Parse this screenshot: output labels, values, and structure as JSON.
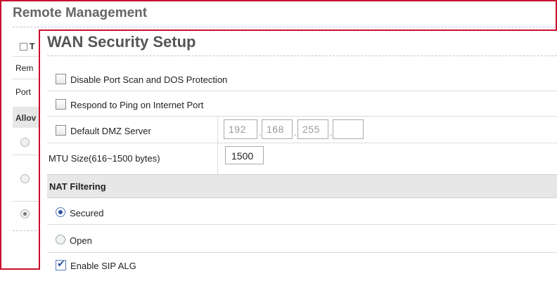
{
  "back_panel": {
    "title": "Remote Management",
    "header_checkbox_label": "T",
    "rows": [
      "Rem",
      "Port"
    ],
    "allow_section_label": "Allov",
    "radios": [
      {
        "checked": false
      },
      {
        "checked": false
      },
      {
        "checked": true
      }
    ]
  },
  "front_panel": {
    "title": "WAN Security Setup",
    "options": {
      "disable_port_scan": {
        "label": "Disable Port Scan and DOS Protection",
        "checked": false
      },
      "respond_ping": {
        "label": "Respond to Ping on Internet Port",
        "checked": false
      },
      "dmz": {
        "label": "Default DMZ Server",
        "checked": false,
        "ip": [
          "192",
          "168",
          "255",
          ""
        ]
      }
    },
    "mtu": {
      "label": "MTU Size(616~1500 bytes)",
      "value": "1500"
    },
    "nat_filtering": {
      "heading": "NAT Filtering",
      "options": [
        {
          "label": "Secured",
          "checked": true
        },
        {
          "label": "Open",
          "checked": false
        }
      ]
    },
    "sip_alg": {
      "label": "Enable SIP ALG",
      "checked": true
    }
  },
  "colors": {
    "panel_border": "#c8102e",
    "section_bg": "#e7e7e7",
    "accent": "#2d4fa0"
  }
}
